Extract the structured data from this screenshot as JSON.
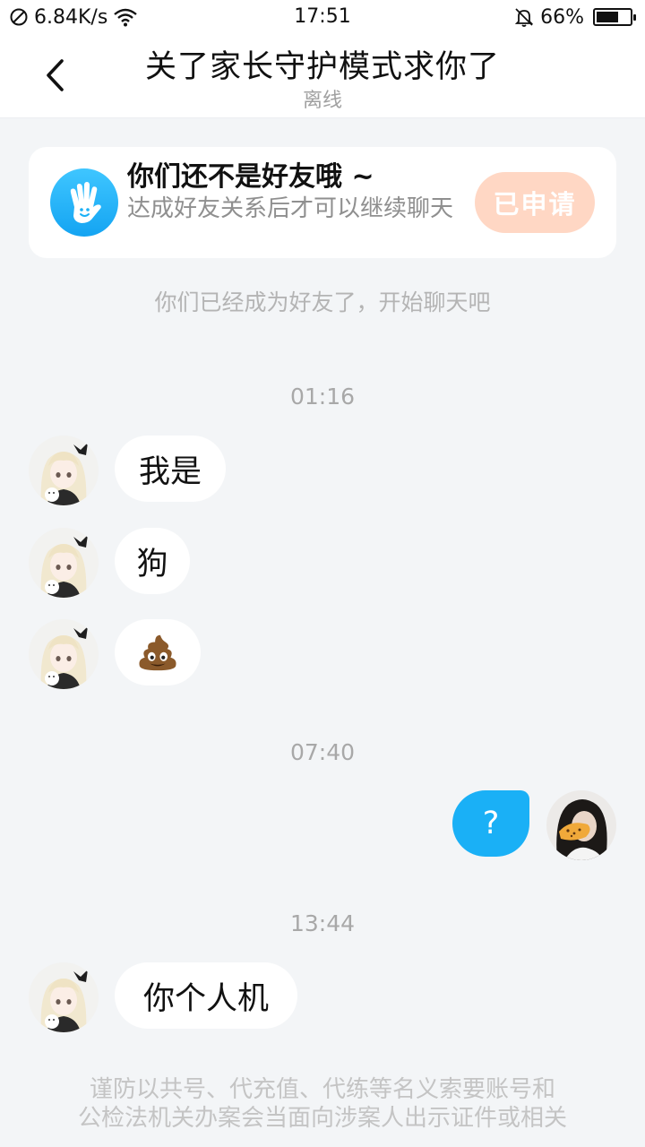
{
  "status_bar": {
    "network_speed": "6.84K/s",
    "time": "17:51",
    "battery_percent": "66%",
    "battery_level": 0.66
  },
  "header": {
    "title": "关了家长守护模式求你了",
    "subtitle": "离线"
  },
  "friend_card": {
    "title": "你们还不是好友哦 ~",
    "description": "达成好友关系后才可以继续聊天",
    "button_label": "已申请"
  },
  "system_notice": "你们已经成为好友了，开始聊天吧",
  "messages": [
    {
      "time": "01:16"
    },
    {
      "side": "left",
      "text": "我是"
    },
    {
      "side": "left",
      "text": "狗"
    },
    {
      "side": "left",
      "text": "💩"
    },
    {
      "time": "07:40"
    },
    {
      "side": "right",
      "text": "?"
    },
    {
      "time": "13:44"
    },
    {
      "side": "left",
      "text": "你个人机"
    }
  ],
  "footer_warning": {
    "line1": "谨防以共号、代充值、代练等名义索要账号和",
    "line2": "公检法机关办案会当面向涉案人出示证件或相关"
  },
  "colors": {
    "accent_blue": "#1ab0f6",
    "applied_button": "#ffd7c4",
    "background": "#f3f5f7"
  }
}
